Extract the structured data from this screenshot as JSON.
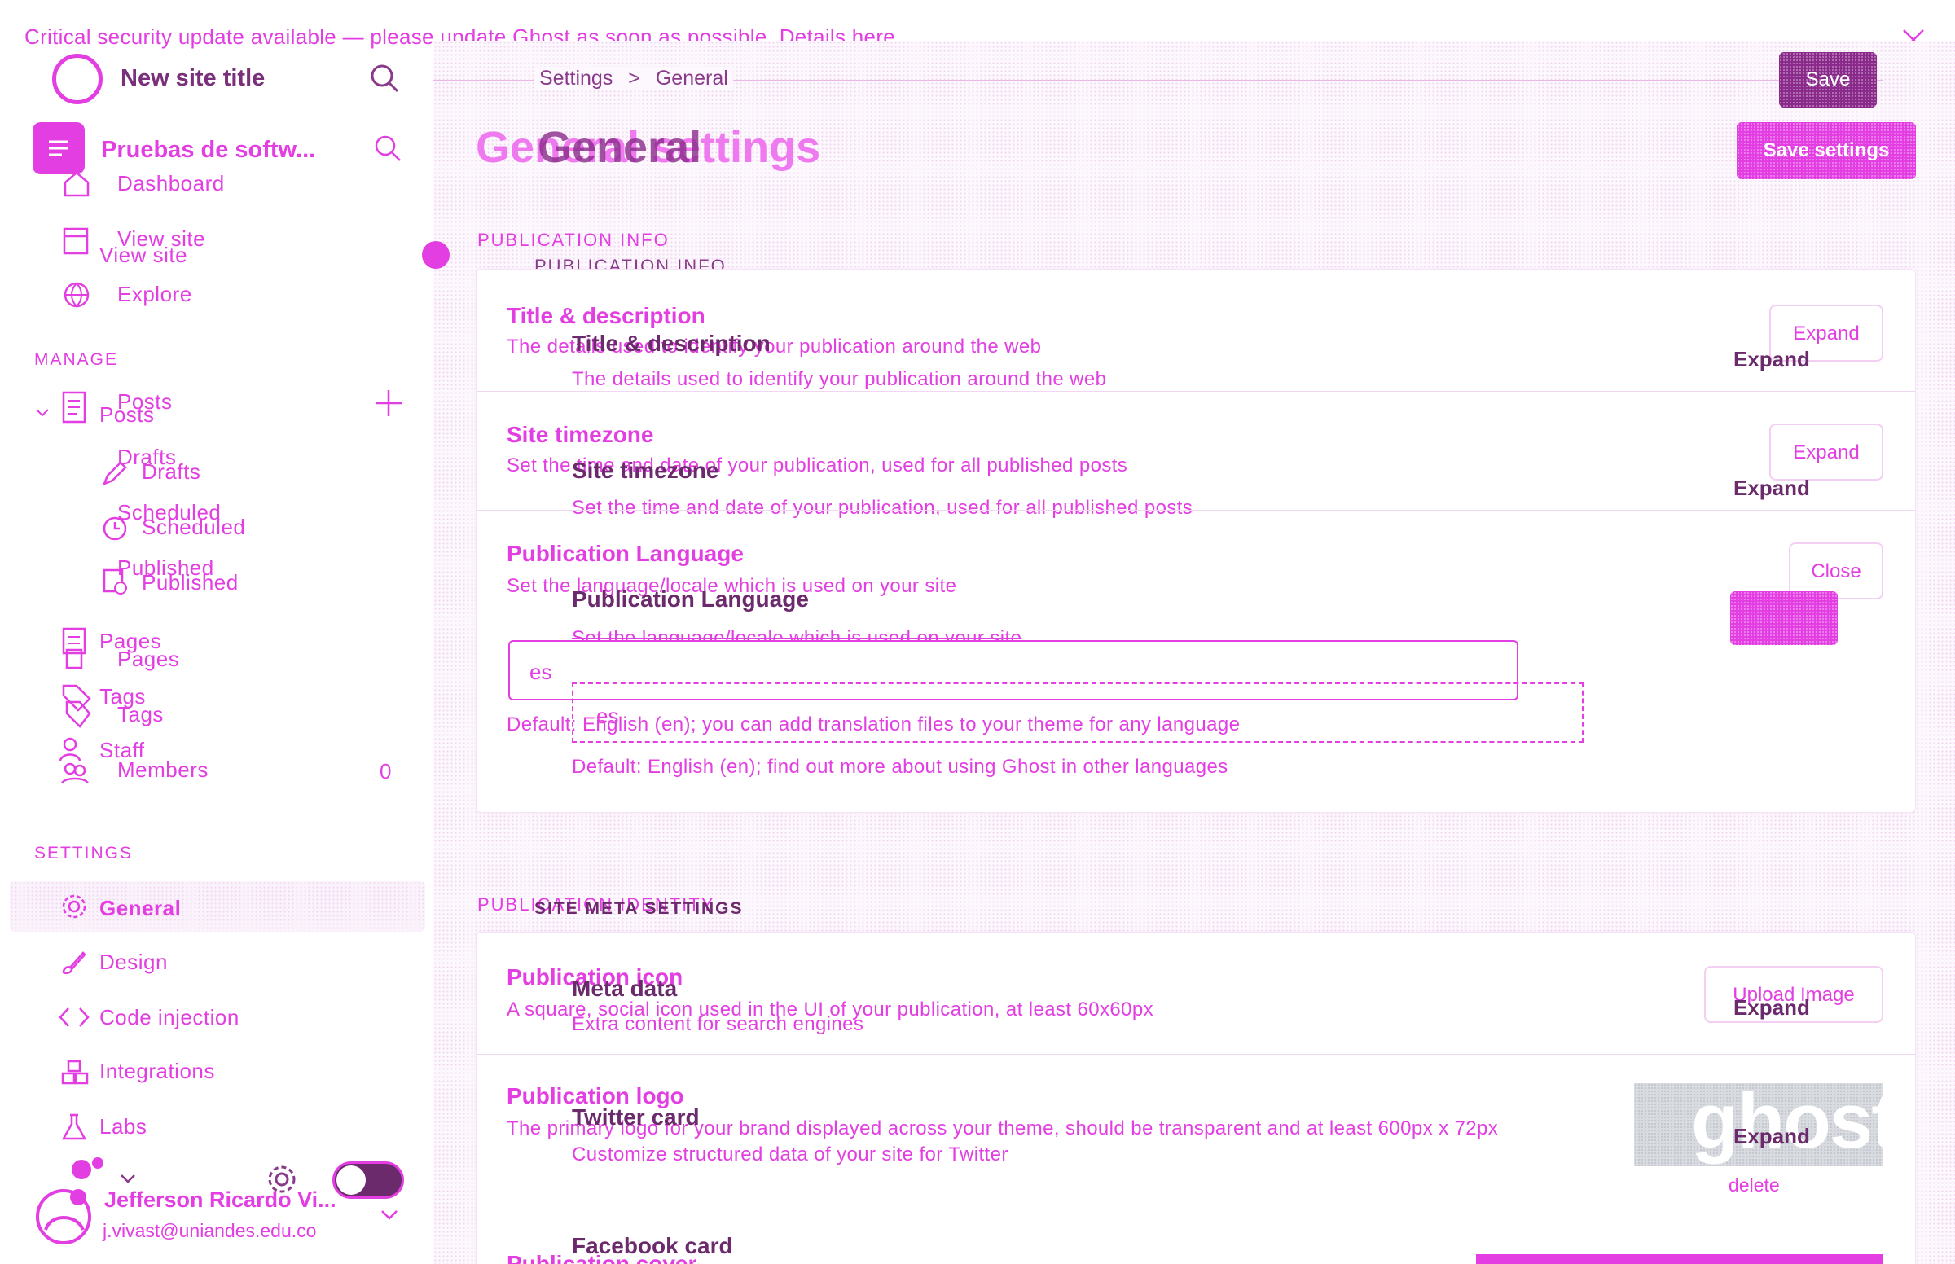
{
  "banner": {
    "text": "Critical security update available — please update Ghost as soon as possible.",
    "link": "Details here."
  },
  "sidebar": {
    "site_title": "New site title",
    "site_title_ghost": "Pruebas de softw...",
    "nav_top": [
      {
        "label": "Dashboard",
        "icon": "house-icon"
      },
      {
        "label": "View site",
        "icon": "browser-icon"
      },
      {
        "label": "Explore",
        "icon": "globe-icon"
      }
    ],
    "view_site_ghost": "View site",
    "manage_caption": "MANAGE",
    "posts_label": "Posts",
    "posts_ghost": "Posts",
    "sub_items": [
      {
        "label": "Drafts",
        "ghost": "Drafts"
      },
      {
        "label": "Scheduled",
        "ghost": "Scheduled"
      },
      {
        "label": "Published",
        "ghost": "Published"
      }
    ],
    "pages_label": "Pages",
    "pages_ghost": "Pages",
    "tags_label": "Tags",
    "tags_ghost": "Tags",
    "staff_label": "Staff",
    "members_label": "Members",
    "members_count": "0",
    "settings_caption": "SETTINGS",
    "settings_items": [
      {
        "label": "General",
        "icon": "gear-icon",
        "active": true
      },
      {
        "label": "Design",
        "icon": "brush-icon"
      },
      {
        "label": "Code injection",
        "icon": "code-icon"
      },
      {
        "label": "Integrations",
        "icon": "integrations-icon"
      },
      {
        "label": "Labs",
        "icon": "flask-icon"
      }
    ],
    "user_name": "Jefferson Ricardo Vi...",
    "user_email": "j.vivast@uniandes.edu.co"
  },
  "header": {
    "breadcrumb_parent": "Settings",
    "breadcrumb_current": "General",
    "title": "General settings",
    "title_ghost": "General",
    "save_button": "Save settings",
    "save_ghost": "Save"
  },
  "publication_info": {
    "caption": "PUBLICATION INFO",
    "caption_ghost": "PUBLICATION INFO",
    "rows": [
      {
        "title": "Title & description",
        "desc": "The details used to identify your publication around the web",
        "ghost_title": "Title & description",
        "ghost_desc": "The details used to identify your publication around the web",
        "button": "Expand",
        "ghost_button": "Expand"
      },
      {
        "title": "Site timezone",
        "desc": "Set the time and date of your publication, used for all published posts",
        "ghost_title": "Site timezone",
        "ghost_desc": "Set the time and date of your publication, used for all published posts",
        "button": "Expand",
        "ghost_button": "Expand"
      },
      {
        "title": "Publication Language",
        "desc": "Set the language/locale which is used on your site",
        "ghost_title": "Publication Language",
        "ghost_desc": "Set the language/locale which is used on your site",
        "button": "Close",
        "ghost_button": "Close"
      }
    ],
    "language_input_value": "es",
    "language_input_ghost": "es",
    "language_help": "Default: English (en); you can add translation files to your theme for any language",
    "language_help_ghost": "Default: English (en); find out more about using Ghost in other languages"
  },
  "publication_identity": {
    "caption": "PUBLICATION IDENTITY",
    "caption_ghost": "SITE META SETTINGS",
    "rows": [
      {
        "title": "Publication icon",
        "desc": "A square, social icon used in the UI of your publication, at least 60x60px",
        "ghost_title": "Meta data",
        "ghost_desc": "Extra content for search engines",
        "button": "Upload Image",
        "ghost_button": "Expand"
      },
      {
        "title": "Publication logo",
        "desc": "The primary logo for your brand displayed across your theme, should be transparent and at least 600px x 72px",
        "ghost_title": "Twitter card",
        "ghost_desc": "Customize structured data of your site for Twitter",
        "logo_text": "ghost",
        "delete": "delete",
        "ghost_button": "Expand"
      },
      {
        "title": "Publication cover",
        "ghost_title": "Facebook card"
      }
    ]
  },
  "colors": {
    "accent": "#e23ee2",
    "ghost_dark": "#6b2a6b",
    "background": "#ffffff"
  }
}
